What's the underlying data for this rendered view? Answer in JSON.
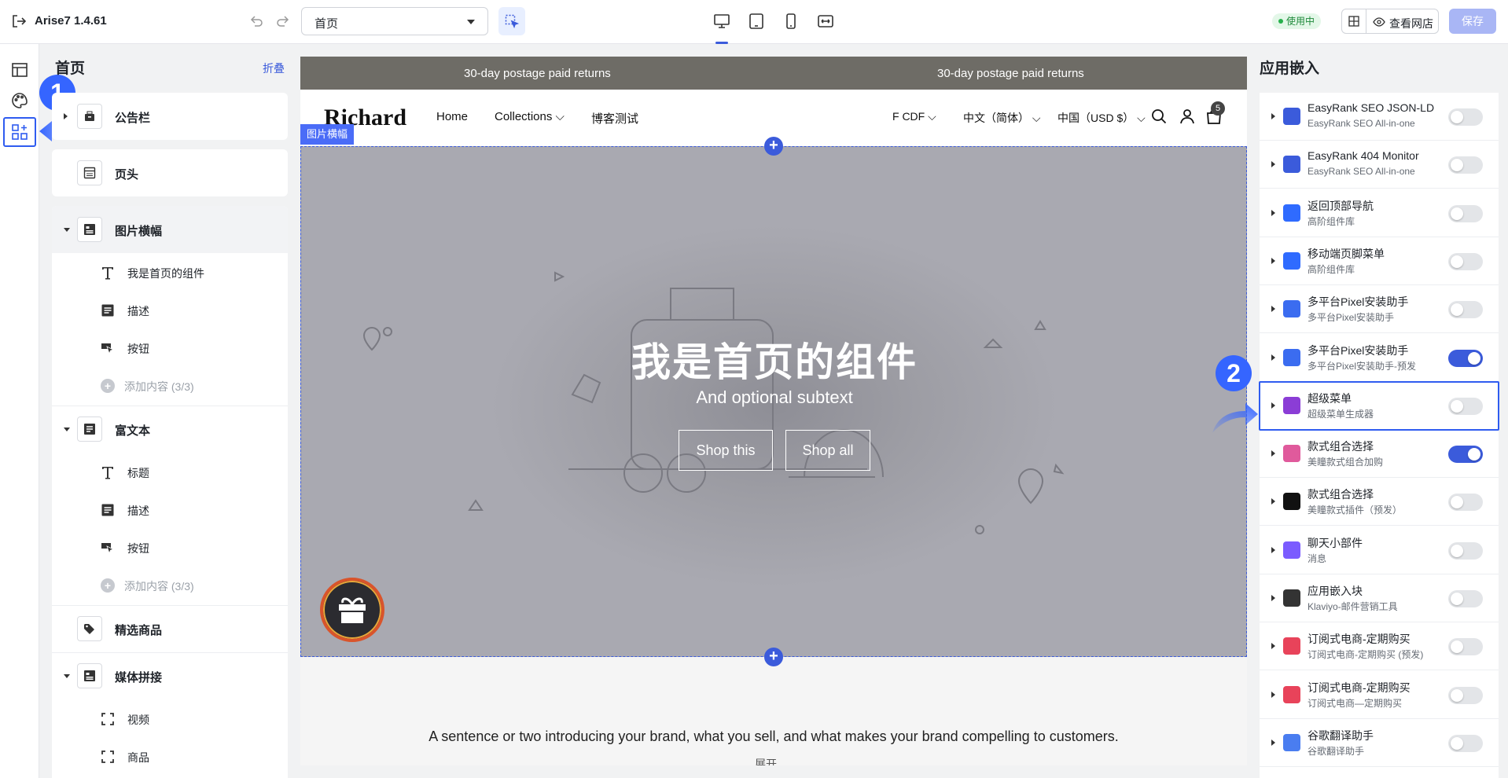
{
  "topbar": {
    "app_title": "Arise7  1.4.61",
    "page_select_value": "首页",
    "status_badge": "使用中",
    "view_store": "查看网店",
    "save": "保存"
  },
  "callouts": {
    "one": "1",
    "two": "2"
  },
  "left_panel": {
    "title": "首页",
    "collapse": "折叠",
    "sections": {
      "announcement": "公告栏",
      "header": "页头",
      "image_banner": "图片横幅",
      "banner_heading": "我是首页的组件",
      "banner_desc": "描述",
      "banner_button": "按钮",
      "banner_add": "添加内容 (3/3)",
      "rich_text": "富文本",
      "rt_title": "标题",
      "rt_desc": "描述",
      "rt_button": "按钮",
      "rt_add": "添加内容 (3/3)",
      "featured": "精选商品",
      "media": "媒体拼接",
      "media_video": "视频",
      "media_product": "商品"
    }
  },
  "preview": {
    "announcement_left": "30-day postage paid returns",
    "announcement_right": "30-day postage paid returns",
    "logo": "Richard",
    "nav": {
      "home": "Home",
      "collections": "Collections",
      "blog": "博客测试"
    },
    "currency": "F CDF",
    "language": "中文（简体）",
    "region": "中国（USD $）",
    "cart_count": "5",
    "section_tag": "图片横幅",
    "hero_title": "我是首页的组件",
    "hero_subtitle": "And optional subtext",
    "btn_shop_this": "Shop this",
    "btn_shop_all": "Shop all",
    "intro": "A sentence or two introducing your brand, what you sell, and what makes your brand compelling to customers.",
    "expand": "展开"
  },
  "right_panel": {
    "title": "应用嵌入",
    "apps": [
      {
        "name": "EasyRank SEO JSON-LD",
        "sub": "EasyRank SEO All-in-one",
        "on": false,
        "color": "#3b5bdb"
      },
      {
        "name": "EasyRank 404 Monitor",
        "sub": "EasyRank SEO All-in-one",
        "on": false,
        "color": "#3b5bdb"
      },
      {
        "name": "返回顶部导航",
        "sub": "高阶组件库",
        "on": false,
        "color": "#2f6bff"
      },
      {
        "name": "移动端页脚菜单",
        "sub": "高阶组件库",
        "on": false,
        "color": "#2f6bff"
      },
      {
        "name": "多平台Pixel安装助手",
        "sub": "多平台Pixel安装助手",
        "on": false,
        "color": "#3b6cf0"
      },
      {
        "name": "多平台Pixel安装助手",
        "sub": "多平台Pixel安装助手-预发",
        "on": true,
        "color": "#3b6cf0"
      },
      {
        "name": "超级菜单",
        "sub": "超级菜单生成器",
        "on": false,
        "color": "#8b3dd6"
      },
      {
        "name": "款式组合选择",
        "sub": "美瞳款式组合加购",
        "on": true,
        "color": "#e05a9c"
      },
      {
        "name": "款式组合选择",
        "sub": "美瞳款式插件（预发）",
        "on": false,
        "color": "#111111"
      },
      {
        "name": "聊天小部件",
        "sub": "消息",
        "on": false,
        "color": "#7b5cff"
      },
      {
        "name": "应用嵌入块",
        "sub": "Klaviyo-邮件营销工具",
        "on": false,
        "color": "#333333"
      },
      {
        "name": "订阅式电商-定期购买",
        "sub": "订阅式电商-定期购买 (预发)",
        "on": false,
        "color": "#e8435a"
      },
      {
        "name": "订阅式电商-定期购买",
        "sub": "订阅式电商—定期购买",
        "on": false,
        "color": "#e8435a"
      },
      {
        "name": "谷歌翻译助手",
        "sub": "谷歌翻译助手",
        "on": false,
        "color": "#4a7df0"
      }
    ]
  }
}
